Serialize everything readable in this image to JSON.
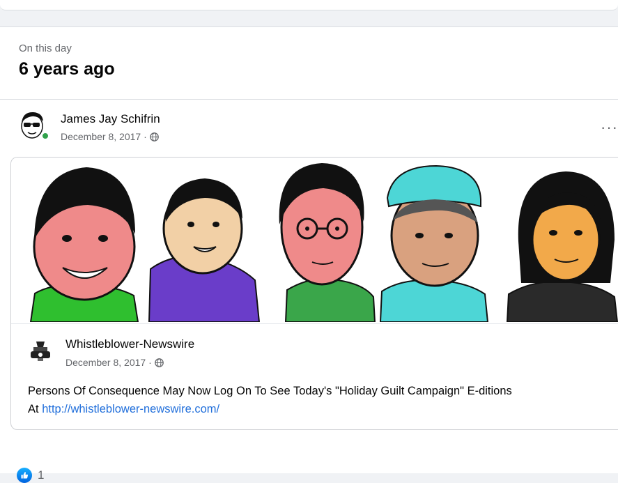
{
  "memory": {
    "label": "On this day",
    "title": "6 years ago"
  },
  "post": {
    "author": "James Jay Schifrin",
    "date": "December 8, 2017 · ",
    "privacy_icon": "globe-icon",
    "more_label": "···"
  },
  "shared_post": {
    "page_name": "Whistleblower-Newswire",
    "date": "December 8, 2017 · ",
    "text": "Persons Of Consequence May Now Log On To See Today's \"Holiday Guilt Campaign\" E-ditions",
    "text_prefix": "At ",
    "link": "http://whistleblower-newswire.com/"
  },
  "reactions": {
    "icon": "like-icon",
    "count": "1"
  },
  "colors": {
    "link": "#216fdb",
    "like": "#0a7cff",
    "online": "#31a24c",
    "secondary_text": "#65676b"
  }
}
